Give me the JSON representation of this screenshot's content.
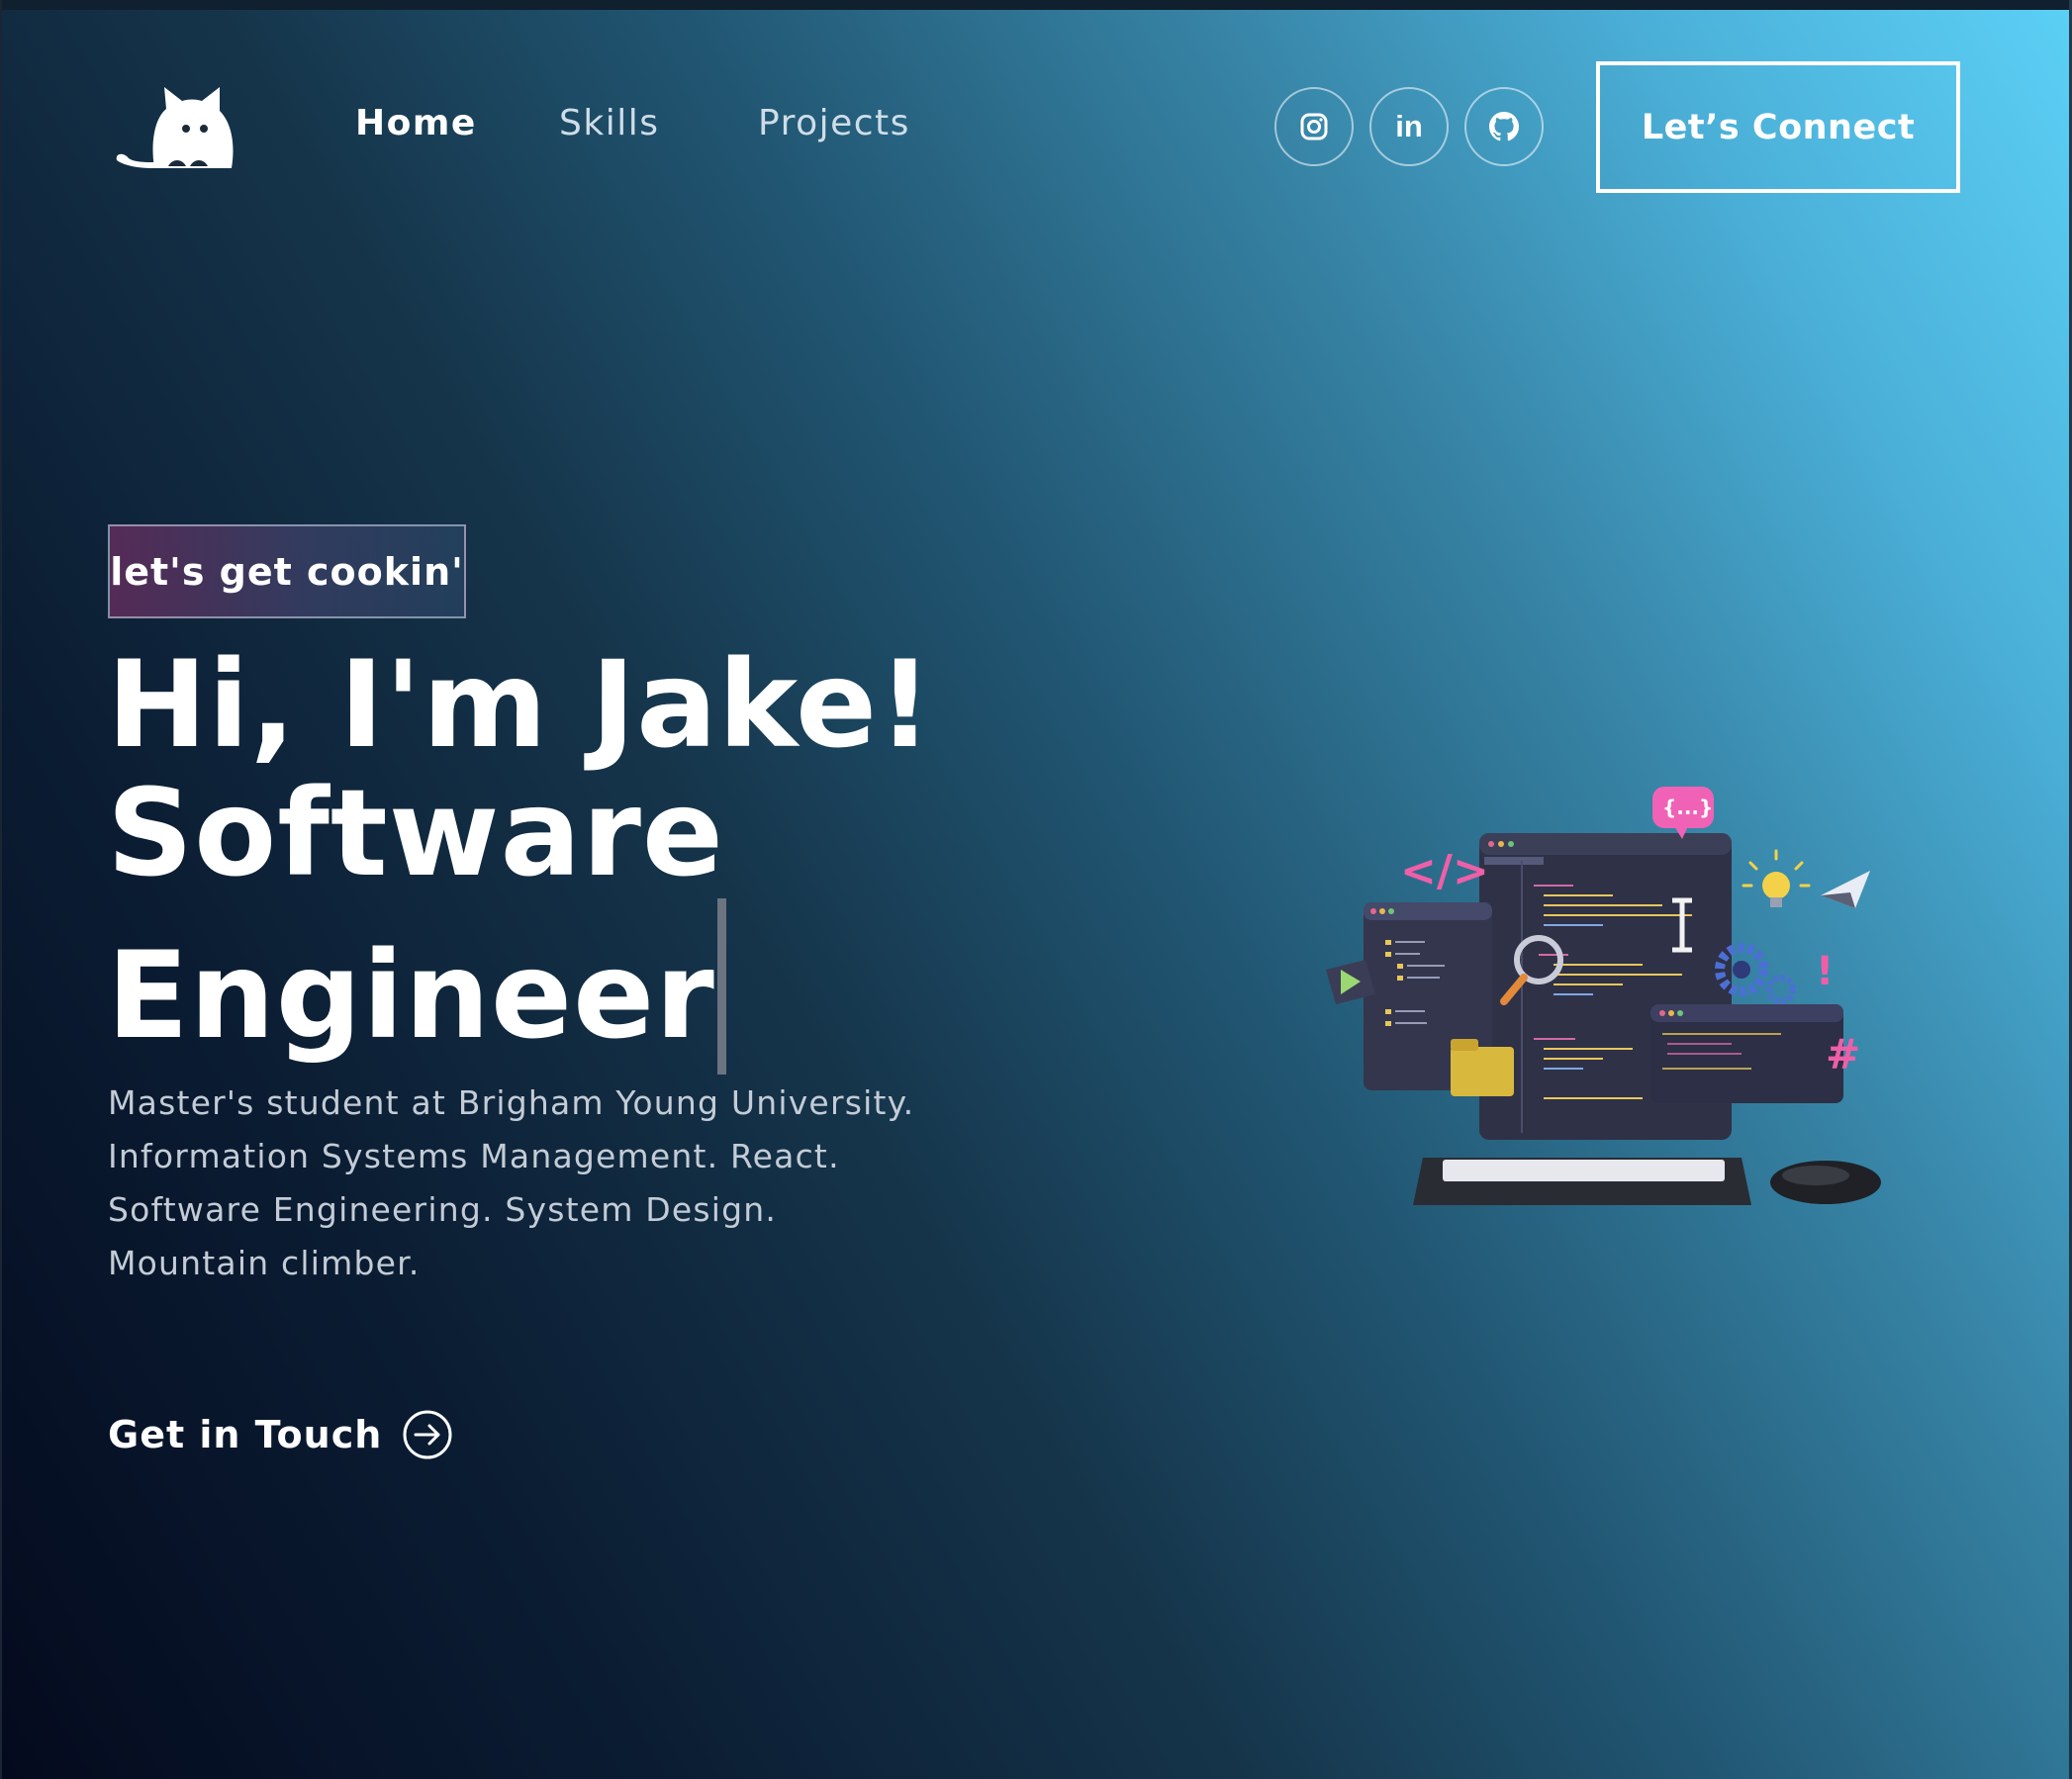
{
  "nav": {
    "links": [
      "Home",
      "Skills",
      "Projects"
    ],
    "social_icons": [
      "instagram-icon",
      "linkedin-icon",
      "github-icon"
    ],
    "linkedin_glyph": "in",
    "connect_label": "Let’s Connect"
  },
  "hero": {
    "tagline": "let's get cookin'",
    "headline_line1": "Hi, I'm Jake!",
    "headline_line2": "Software",
    "headline_line3": "Engineer",
    "bio": [
      "Master's student at Brigham Young University.",
      "Information Systems Management. React.",
      "Software Engineering. System Design.",
      "Mountain climber."
    ],
    "cta_label": "Get in Touch"
  },
  "colors": {
    "gradient_dark": "#040a1e",
    "gradient_light": "#5cd0f6",
    "text": "#ffffff",
    "muted_text": "#c3ccd6"
  }
}
